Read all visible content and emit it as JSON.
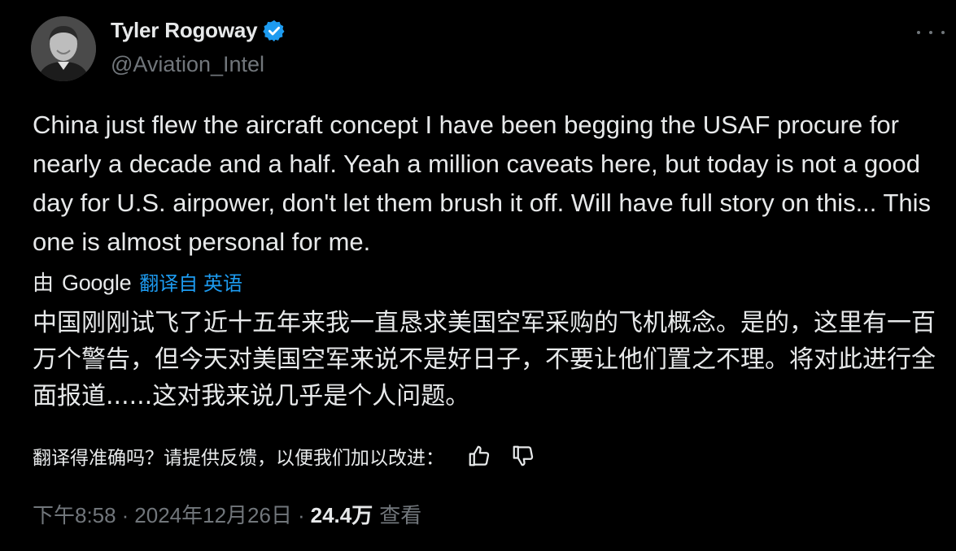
{
  "author": {
    "display_name": "Tyler Rogoway",
    "handle": "@Aviation_Intel",
    "verified": true,
    "avatar_icon": "person-avatar"
  },
  "tweet": {
    "text": "China just flew the aircraft concept I have been begging the USAF procure for nearly a decade and a half. Yeah a million caveats here, but today is not a good day for U.S. airpower, don't let them brush it off. Will have full story on this... This one is almost personal for me."
  },
  "translation": {
    "by_label": "由",
    "provider": "Google",
    "translated_from": "翻译自 英语",
    "text": "中国刚刚试飞了近十五年来我一直恳求美国空军采购的飞机概念。是的，这里有一百万个警告，但今天对美国空军来说不是好日子，不要让他们置之不理。将对此进行全面报道......这对我来说几乎是个人问题。",
    "feedback_prompt": "翻译得准确吗？请提供反馈，以便我们加以改进：",
    "thumbs_up_icon": "thumbs-up-icon",
    "thumbs_down_icon": "thumbs-down-icon"
  },
  "meta": {
    "time": "下午8:58",
    "separator": "·",
    "date": "2024年12月26日",
    "views_count": "24.4万",
    "views_label": "查看"
  },
  "colors": {
    "background": "#000000",
    "text": "#e7e9ea",
    "muted": "#71767b",
    "accent": "#1d9bf0"
  }
}
